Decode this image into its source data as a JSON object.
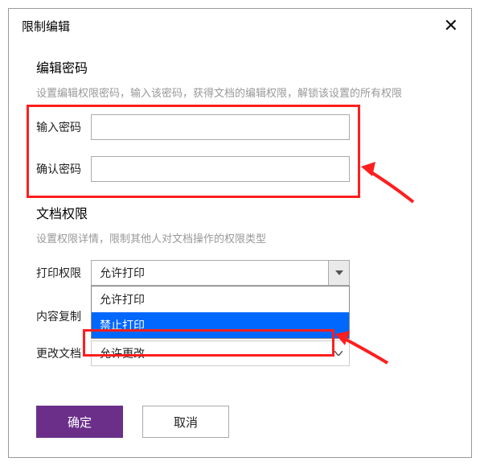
{
  "dialog": {
    "title": "限制编辑"
  },
  "section_password": {
    "title": "编辑密码",
    "desc": "设置编辑权限密码，输入该密码，获得文档的编辑权限，解锁该设置的所有权限",
    "input_label": "输入密码",
    "confirm_label": "确认密码"
  },
  "section_permissions": {
    "title": "文档权限",
    "desc": "设置权限详情，限制其他人对文档操作的权限类型",
    "print": {
      "label": "打印权限",
      "value": "允许打印",
      "options": [
        "允许打印",
        "禁止打印"
      ],
      "highlighted_index": 1
    },
    "copy": {
      "label": "内容复制"
    },
    "change": {
      "label": "更改文档",
      "value": "允许更改"
    }
  },
  "buttons": {
    "ok": "确定",
    "cancel": "取消"
  },
  "colors": {
    "primary": "#6b2f8a",
    "annotation": "#ff1e1e",
    "dropdown_selected": "#0067ff"
  }
}
